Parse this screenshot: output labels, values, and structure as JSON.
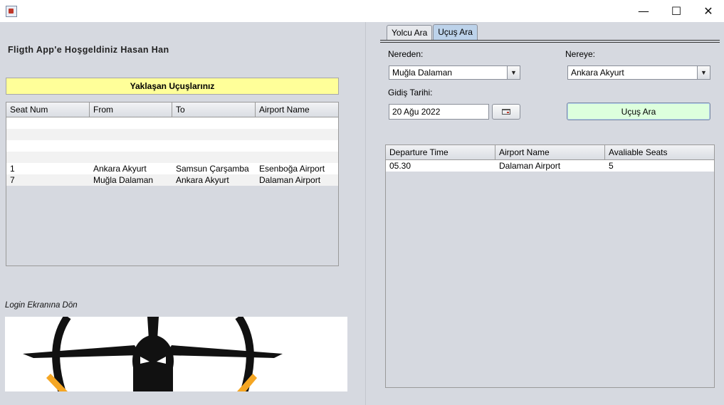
{
  "window": {
    "minimize_glyph": "—",
    "maximize_glyph": "☐",
    "close_glyph": "✕"
  },
  "left": {
    "welcome_text": "Fligth App'e Hoşgeldiniz  Hasan Han",
    "upcoming_title": "Yaklaşan Uçuşlarınız",
    "upcoming_table": {
      "columns": [
        "Seat Num",
        "From",
        "To",
        "Airport Name"
      ],
      "rows": [
        [
          "",
          "",
          "",
          ""
        ],
        [
          "",
          "",
          "",
          ""
        ],
        [
          "",
          "",
          "",
          ""
        ],
        [
          "",
          "",
          "",
          ""
        ],
        [
          "1",
          "Ankara Akyurt",
          "Samsun Çarşamba",
          "Esenboğa Airport"
        ],
        [
          "7",
          "Muğla Dalaman",
          "Ankara Akyurt",
          "Dalaman Airport"
        ]
      ]
    },
    "login_link": "Login Ekranına Dön"
  },
  "right": {
    "tabs": [
      "Yolcu Ara",
      "Uçuş Ara"
    ],
    "active_tab": "Uçuş Ara",
    "from_label": "Nereden:",
    "from_value": "Muğla Dalaman",
    "to_label": "Nereye:",
    "to_value": "Ankara Akyurt",
    "date_label": "Gidiş Tarihi:",
    "date_value": "20 Ağu 2022",
    "search_button": "Uçuş Ara",
    "results_table": {
      "columns": [
        "Departure Time",
        "Airport Name",
        "Avaliable Seats"
      ],
      "rows": [
        [
          "05.30",
          "Dalaman Airport",
          "5"
        ]
      ]
    }
  },
  "colors": {
    "upcoming_bar": "#ffff99",
    "search_button": "#ddffdd",
    "active_tab": "#bcd2ea",
    "logo_orange": "#f5a623"
  },
  "icons": {
    "app": "java-cup-icon",
    "calendar": "calendar-icon",
    "combo_arrow": "triangle-down-icon",
    "logo": "airplane-logo"
  }
}
